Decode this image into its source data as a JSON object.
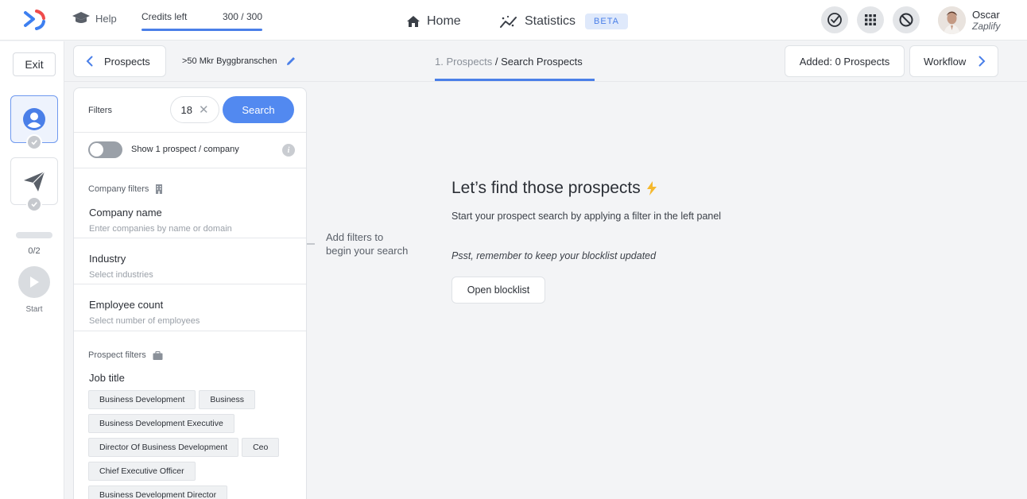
{
  "topbar": {
    "help_label": "Help",
    "credits": {
      "label": "Credits left",
      "value": "300 / 300",
      "used_fraction": 1.0
    },
    "nav": {
      "home": "Home",
      "statistics": "Statistics",
      "beta": "BETA"
    },
    "icons": [
      "check-circle-icon",
      "apps-grid-icon",
      "block-icon"
    ],
    "user": {
      "name": "Oscar",
      "org": "Zaplify"
    }
  },
  "rail": {
    "exit": "Exit",
    "progress": "0/2",
    "start": "Start"
  },
  "subheader": {
    "back_label": "Prospects",
    "campaign_name": ">50 Mkr Byggbranschen",
    "breadcrumb_step": "1. Prospects",
    "breadcrumb_sep": " / ",
    "breadcrumb_current": "Search Prospects",
    "added": "Added: 0 Prospects",
    "workflow": "Workflow"
  },
  "filters": {
    "label": "Filters",
    "count": "18",
    "search": "Search",
    "toggle_label": "Show 1 prospect / company",
    "company_section": "Company filters",
    "company_name": {
      "label": "Company name",
      "placeholder": "Enter companies by name or domain"
    },
    "industry": {
      "label": "Industry",
      "placeholder": "Select industries"
    },
    "employee": {
      "label": "Employee count",
      "placeholder": "Select number of employees"
    },
    "prospect_section": "Prospect filters",
    "job_title": "Job title",
    "tags": [
      "Business Development",
      "Business",
      "Business Development Executive",
      "Director Of Business Development",
      "Ceo",
      "Chief Executive Officer",
      "Business Development Director"
    ]
  },
  "hint": {
    "line1": "Add filters to",
    "line2": "begin your search"
  },
  "main": {
    "title": "Let’s find those prospects",
    "subtitle": "Start your prospect search by applying a filter in the left panel",
    "psst": "Psst, remember to keep your blocklist updated",
    "blocklist_button": "Open blocklist"
  },
  "colors": {
    "accent": "#5289f0",
    "bolt": "#f5b82e",
    "logo_red": "#ef4b4b",
    "logo_blue": "#3d7ff0"
  }
}
